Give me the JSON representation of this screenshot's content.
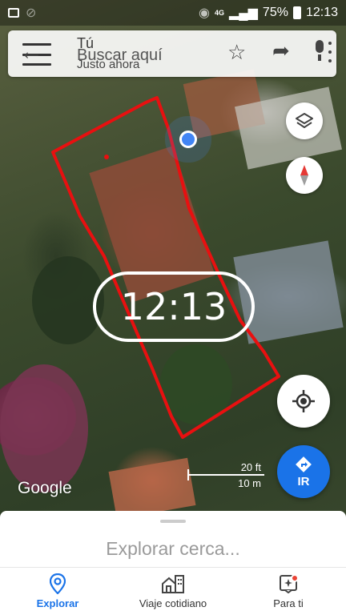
{
  "status_bar": {
    "network": "4G",
    "battery": "75%",
    "time": "12:13"
  },
  "search": {
    "title": "Tú",
    "placeholder": "Buscar aquí",
    "subtitle": "Justo ahora"
  },
  "map": {
    "clock_overlay": "12:13",
    "scale_ft": "20 ft",
    "scale_m": "10 m",
    "logo": "Google",
    "drawing_color": "#e81010"
  },
  "buttons": {
    "go_label": "IR"
  },
  "sheet": {
    "explore_label": "Explorar cerca..."
  },
  "bottom_nav": [
    {
      "label": "Explorar",
      "icon": "pin-icon",
      "active": true
    },
    {
      "label": "Viaje cotidiano",
      "icon": "home-city-icon",
      "active": false
    },
    {
      "label": "Para ti",
      "icon": "sparkle-icon",
      "active": false
    }
  ],
  "colors": {
    "accent": "#1a73e8",
    "my_location": "#4285f4",
    "badge": "#ea4335"
  }
}
